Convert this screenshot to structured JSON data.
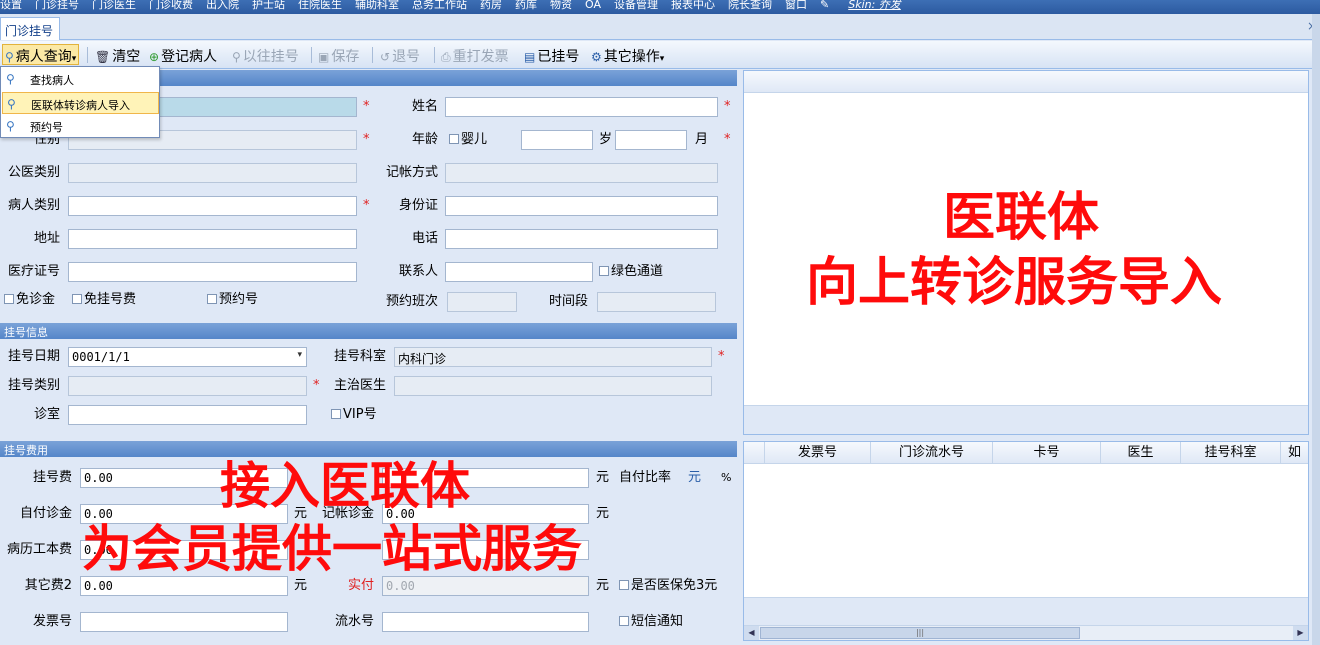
{
  "menubar": {
    "items": [
      "设置",
      "门诊挂号",
      "门诊医生",
      "门诊收费",
      "出入院",
      "护士站",
      "住院医生",
      "辅助科室",
      "总务工作站",
      "药房",
      "药库",
      "物资",
      "OA",
      "设备管理",
      "报表中心",
      "院长查询",
      "窗口"
    ],
    "skin": "Skin: 乔发"
  },
  "tab": {
    "label": "门诊挂号",
    "close": "×"
  },
  "toolbar": {
    "patient_query": "病人查询",
    "clear": "清空",
    "register_patient": "登记病人",
    "previous_registration": "以往挂号",
    "save": "保存",
    "cancel_registration": "退号",
    "reprint_invoice": "重打发票",
    "registered": "已挂号",
    "other_ops": "其它操作"
  },
  "dropdown": {
    "items": [
      "查找病人",
      "医联体转诊病人导入",
      "预约号"
    ]
  },
  "patient_panel": {
    "name_label": "姓名",
    "gender_label": "性别",
    "age_label": "年龄",
    "infant_label": "婴儿",
    "year_unit": "岁",
    "month_unit": "月",
    "medical_category_label": "公医类别",
    "billing_method_label": "记帐方式",
    "patient_category_label": "病人类别",
    "id_card_label": "身份证",
    "address_label": "地址",
    "phone_label": "电话",
    "medical_cert_label": "医疗证号",
    "contact_label": "联系人",
    "green_channel_label": "绿色通道",
    "free_consult_label": "免诊金",
    "free_reg_fee_label": "免挂号费",
    "appointment_label": "预约号",
    "appointment_shift_label": "预约班次",
    "time_slot_label": "时间段"
  },
  "registration_panel": {
    "title": "挂号信息",
    "reg_date_label": "挂号日期",
    "reg_date_value": "0001/1/1",
    "reg_dept_label": "挂号科室",
    "reg_dept_value": "内科门诊",
    "reg_type_label": "挂号类别",
    "doctor_label": "主治医生",
    "room_label": "诊室",
    "vip_label": "VIP号"
  },
  "fee_panel": {
    "title": "挂号费用",
    "reg_fee_label": "挂号费",
    "reg_fee_value": "0.00",
    "yuan": "元",
    "self_ratio_label": "自付比率",
    "self_ratio_unit": "元",
    "percent": "%",
    "self_consult_label": "自付诊金",
    "self_consult_value": "0.00",
    "credit_consult_label": "记帐诊金",
    "credit_consult_value": "0.00",
    "record_book_label": "病历工本费",
    "record_book_value": "0.00",
    "other_fee_label": "其它费2",
    "other_fee_value": "0.00",
    "paid_label": "实付",
    "paid_value": "0.00",
    "insurance_free3_label": "是否医保免3元",
    "invoice_no_label": "发票号",
    "serial_no_label": "流水号",
    "sms_label": "短信通知"
  },
  "grid": {
    "columns": [
      "发票号",
      "门诊流水号",
      "卡号",
      "医生",
      "挂号科室",
      "如"
    ]
  },
  "overlay": {
    "right_line1": "医联体",
    "right_line2": "向上转诊服务导入",
    "left_line1": "接入医联体",
    "left_line2": "为会员提供一站式服务"
  },
  "colors": {
    "overlay_red": "#ff0b0b",
    "panel_blue": "#5586c9",
    "required_red": "#e02020"
  }
}
